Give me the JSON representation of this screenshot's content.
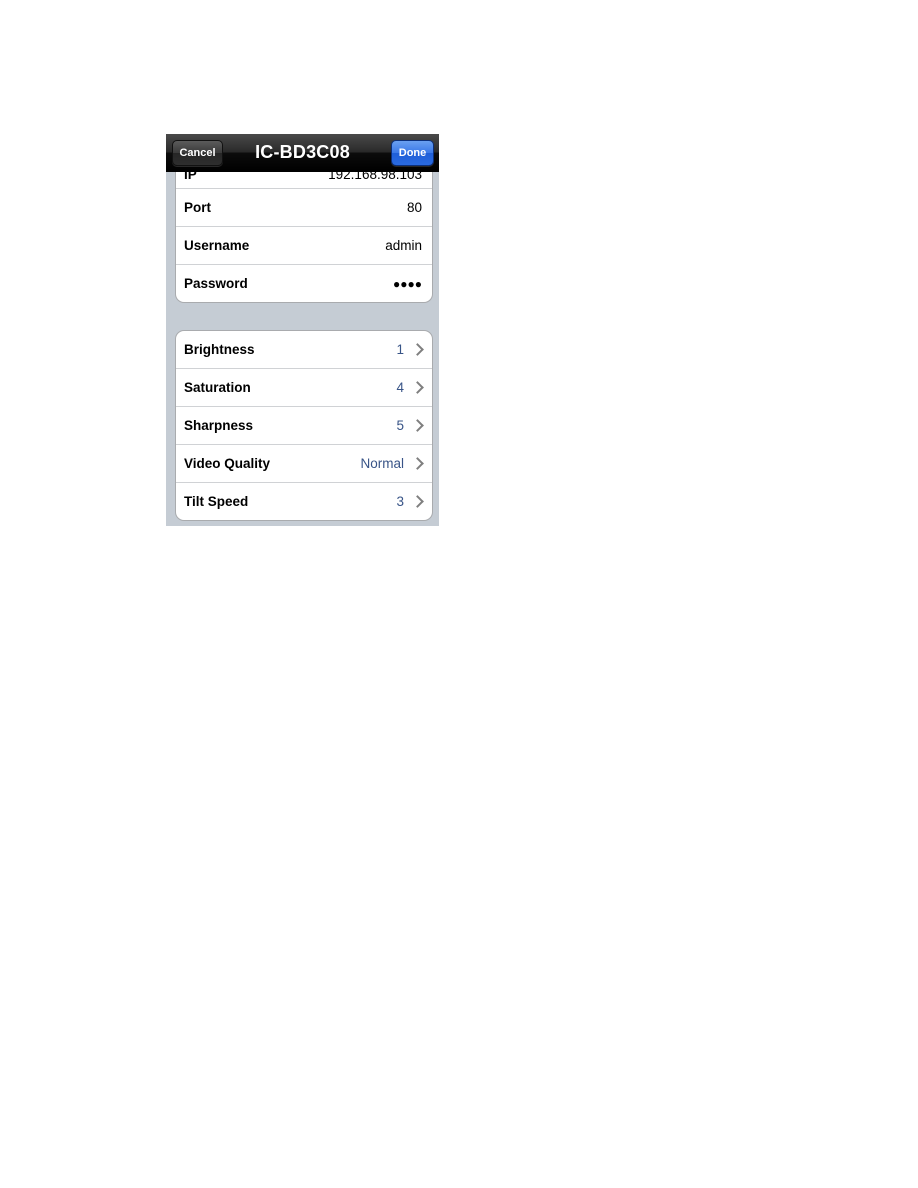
{
  "navbar": {
    "title": "IC-BD3C08",
    "cancel_label": "Cancel",
    "done_label": "Done"
  },
  "connection": {
    "rows": [
      {
        "label": "IP",
        "value": "192.168.98.103"
      },
      {
        "label": "Port",
        "value": "80"
      },
      {
        "label": "Username",
        "value": "admin"
      },
      {
        "label": "Password",
        "value": "●●●●"
      }
    ]
  },
  "settings": {
    "rows": [
      {
        "label": "Brightness",
        "value": "1"
      },
      {
        "label": "Saturation",
        "value": "4"
      },
      {
        "label": "Sharpness",
        "value": "5"
      },
      {
        "label": "Video Quality",
        "value": "Normal"
      },
      {
        "label": "Tilt Speed",
        "value": "3"
      }
    ]
  },
  "colors": {
    "background": "#c5ccd4",
    "value_link": "#385487",
    "done_button": "#2a6ae0"
  }
}
